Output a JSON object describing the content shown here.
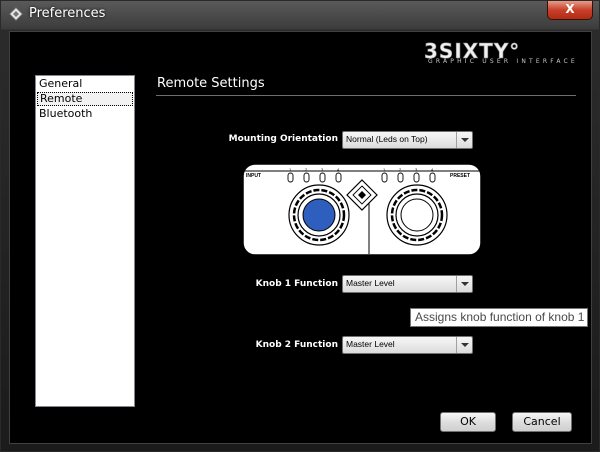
{
  "window": {
    "title": "Preferences",
    "close_label": "X"
  },
  "logo": {
    "brand": "3SIXTY°",
    "subtitle": "GRAPHIC USER INTERFACE"
  },
  "sidebar": {
    "items": [
      {
        "label": "General",
        "selected": false
      },
      {
        "label": "Remote",
        "selected": true
      },
      {
        "label": "Bluetooth",
        "selected": false
      }
    ]
  },
  "main": {
    "section_title": "Remote Settings",
    "mounting": {
      "label": "Mounting Orientation",
      "value": "Normal (Leds on Top)"
    },
    "device": {
      "input_label": "INPUT",
      "preset_label": "PRESET",
      "led_numbers": [
        "1",
        "2",
        "3",
        "4"
      ]
    },
    "knob1": {
      "label": "Knob 1 Function",
      "value": "Master Level"
    },
    "knob2": {
      "label": "Knob 2 Function",
      "value": "Master Level"
    },
    "tooltip": "Assigns knob function of knob 1"
  },
  "buttons": {
    "ok": "OK",
    "cancel": "Cancel"
  },
  "colors": {
    "knob1_active": "#2e5fbf",
    "close_button": "#c7402a"
  }
}
